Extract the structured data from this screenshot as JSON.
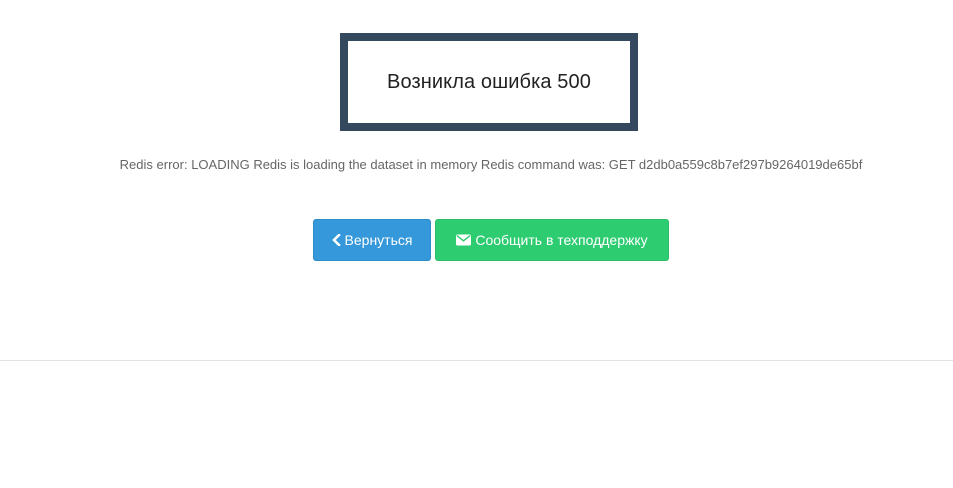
{
  "error": {
    "title": "Возникла ошибка 500",
    "message": "Redis error: LOADING Redis is loading the dataset in memory Redis command was: GET d2db0a559c8b7ef297b9264019de65bf"
  },
  "buttons": {
    "back": {
      "label": "Вернуться",
      "icon": "chevron-left-icon",
      "color": "#3498db"
    },
    "support": {
      "label": "Сообщить в техподдержку",
      "icon": "envelope-icon",
      "color": "#2ecc71"
    }
  },
  "colors": {
    "box_border": "#34495e",
    "divider": "#e2e2e2"
  }
}
